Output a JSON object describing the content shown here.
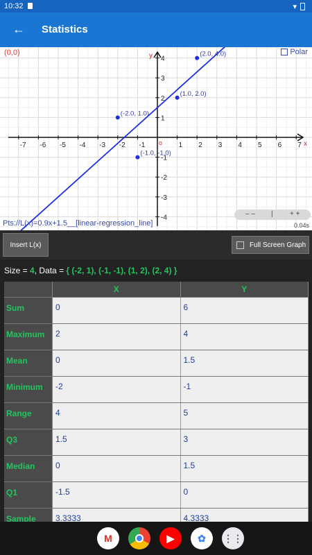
{
  "status": {
    "time": "10:32"
  },
  "app_bar": {
    "title": "Statistics"
  },
  "graph": {
    "origin_text": "(0,0)",
    "polar_label": "Polar",
    "y_axis_label": "y",
    "x_axis_label": "x",
    "origin_tick": "o",
    "x_ticks": [
      "-7",
      "-6",
      "-5",
      "-4",
      "-3",
      "-2",
      "-1",
      "1",
      "2",
      "3",
      "4",
      "5",
      "6",
      "7"
    ],
    "y_ticks": [
      "4",
      "3",
      "2",
      "1",
      "-1",
      "-2",
      "-3",
      "-4"
    ],
    "points": [
      {
        "label": "(-2.0, 1.0)",
        "x": -2,
        "y": 1
      },
      {
        "label": "(-1.0, -1.0)",
        "x": -1,
        "y": -1
      },
      {
        "label": "(1.0, 2.0)",
        "x": 1,
        "y": 2
      },
      {
        "label": "(2.0, 4.0)",
        "x": 2,
        "y": 4
      }
    ],
    "regression": {
      "slope": 0.9,
      "intercept": 1.5,
      "color": "#1d2fe0"
    },
    "expression": "Pts://L(x)=0.9x+1.5__[linear-regression_line]",
    "zoom_minus": "– –",
    "zoom_mid": "|",
    "zoom_plus": "+ +",
    "render_time": "0.04s"
  },
  "toolbar": {
    "insert_label": "Insert L(x)",
    "fullscreen_label": "Full Screen Graph"
  },
  "summary": {
    "size_prefix": "Size = ",
    "size_value": "4",
    "data_prefix": ", Data = ",
    "data_value": "{ (-2, 1), (-1, -1), (1, 2), (2, 4) }"
  },
  "table": {
    "headers": [
      "X",
      "Y"
    ],
    "rows": [
      {
        "label": "Sum",
        "x": "0",
        "y": "6"
      },
      {
        "label": "Maximum",
        "x": "2",
        "y": "4"
      },
      {
        "label": "Mean",
        "x": "0",
        "y": "1.5"
      },
      {
        "label": "Minimum",
        "x": "-2",
        "y": "-1"
      },
      {
        "label": "Range",
        "x": "4",
        "y": "5"
      },
      {
        "label": "Q3",
        "x": "1.5",
        "y": "3"
      },
      {
        "label": "Median",
        "x": "0",
        "y": "1.5"
      },
      {
        "label": "Q1",
        "x": "-1.5",
        "y": "0"
      },
      {
        "label": "Sample",
        "x": "3.3333",
        "y": "4.3333"
      }
    ]
  },
  "dock": [
    "gmail-icon",
    "chrome-icon",
    "youtube-icon",
    "photos-icon",
    "apps-icon"
  ]
}
